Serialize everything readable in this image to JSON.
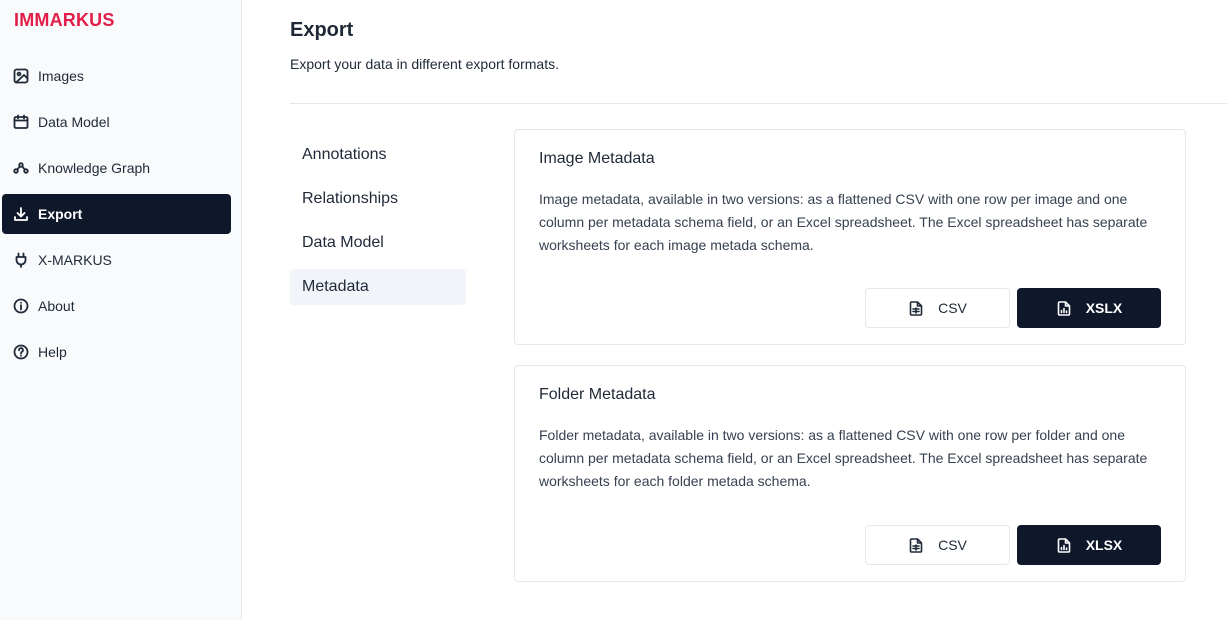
{
  "app": {
    "brand": "IMMARKUS"
  },
  "sidebar": {
    "items": [
      {
        "label": "Images",
        "icon": "image-icon"
      },
      {
        "label": "Data Model",
        "icon": "calendar-icon"
      },
      {
        "label": "Knowledge Graph",
        "icon": "graph-icon"
      },
      {
        "label": "Export",
        "icon": "download-icon",
        "active": true
      },
      {
        "label": "X-MARKUS",
        "icon": "plug-icon"
      },
      {
        "label": "About",
        "icon": "info-icon"
      },
      {
        "label": "Help",
        "icon": "help-icon"
      }
    ]
  },
  "header": {
    "title": "Export",
    "subtitle": "Export your data in different export formats."
  },
  "subnav": {
    "items": [
      {
        "label": "Annotations"
      },
      {
        "label": "Relationships"
      },
      {
        "label": "Data Model"
      },
      {
        "label": "Metadata",
        "active": true
      }
    ]
  },
  "cards": [
    {
      "title": "Image Metadata",
      "description": "Image metadata, available in two versions: as a flattened CSV with one row per image and one column per metadata schema field, or an Excel spreadsheet. The Excel spreadsheet has separate worksheets for each image metada schema.",
      "csv_label": "CSV",
      "excel_label": "XSLX"
    },
    {
      "title": "Folder Metadata",
      "description": "Folder metadata, available in two versions: as a flattened CSV with one row per folder and one column per metadata schema field, or an Excel spreadsheet. The Excel spreadsheet has separate worksheets for each folder metada schema.",
      "csv_label": "CSV",
      "excel_label": "XLSX"
    }
  ],
  "colors": {
    "brand": "#e11d48",
    "dark": "#0f172a",
    "sidebar_bg": "#f8fafc",
    "subnav_active_bg": "#f1f5f9"
  }
}
